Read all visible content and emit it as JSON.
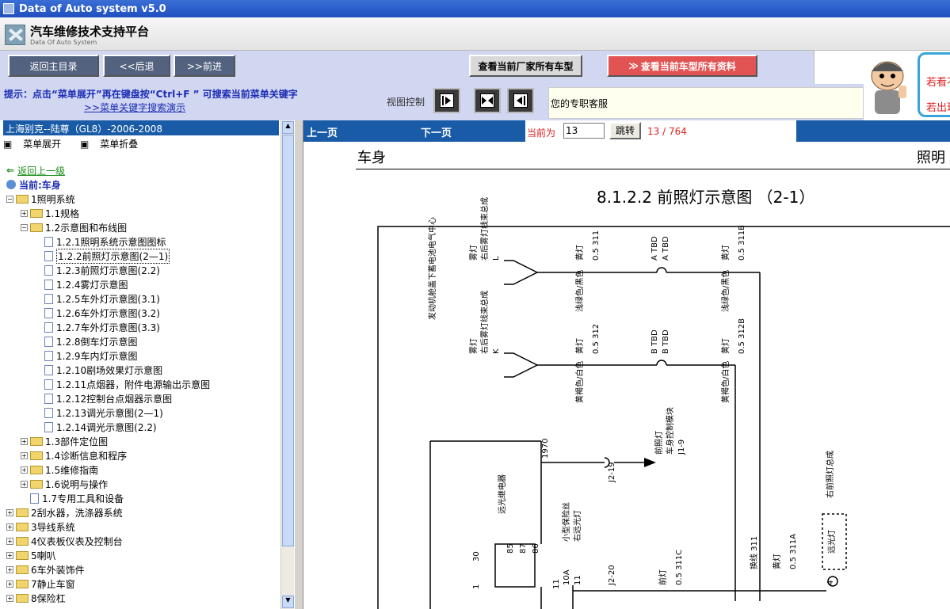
{
  "window": {
    "title": "Data of Auto system v5.0"
  },
  "brand": {
    "title": "汽车维修技术支持平台",
    "subtitle": "Data Of Auto System"
  },
  "nav": {
    "home": "返回主目录",
    "back": "<<后退",
    "forward": ">>前进",
    "makers": "查看当前厂家所有车型",
    "all_data": "查看当前车型所有资料"
  },
  "ad": {
    "line1": "若看不",
    "line2": "若出现"
  },
  "hint": {
    "text": "提示：点击“菜单展开”再在键盘按“Ctrl+F ” 可搜索当前菜单关键字",
    "link": ">>菜单关键字搜索演示",
    "view_control": "视图控制",
    "service": "您的专职客服"
  },
  "tree": {
    "header": "上海别克--陆尊（GL8）-2006-2008",
    "expand": "菜单展开",
    "collapse": "菜单折叠",
    "back_up": "返回上一级",
    "current": "当前:车身",
    "items": [
      {
        "label": "1照明系统",
        "type": "folder",
        "sign": "-",
        "level": 0
      },
      {
        "label": "1.1规格",
        "type": "folder",
        "sign": "+",
        "level": 1
      },
      {
        "label": "1.2示意图和布线图",
        "type": "folder",
        "sign": "-",
        "level": 1
      },
      {
        "label": "1.2.1照明系统示意图图标",
        "type": "doc",
        "level": 2
      },
      {
        "label": "1.2.2前照灯示意图(2—1)",
        "type": "doc",
        "level": 2,
        "selected": true
      },
      {
        "label": "1.2.3前照灯示意图(2.2)",
        "type": "doc",
        "level": 2
      },
      {
        "label": "1.2.4雾灯示意图",
        "type": "doc",
        "level": 2
      },
      {
        "label": "1.2.5车外灯示意图(3.1)",
        "type": "doc",
        "level": 2
      },
      {
        "label": "1.2.6车外灯示意图(3.2)",
        "type": "doc",
        "level": 2
      },
      {
        "label": "1.2.7车外灯示意图(3.3)",
        "type": "doc",
        "level": 2
      },
      {
        "label": "1.2.8倒车灯示意图",
        "type": "doc",
        "level": 2
      },
      {
        "label": "1.2.9车内灯示意图",
        "type": "doc",
        "level": 2
      },
      {
        "label": "1.2.10剧场效果灯示意图",
        "type": "doc",
        "level": 2
      },
      {
        "label": "1.2.11点烟器，附件电源输出示意图",
        "type": "doc",
        "level": 2
      },
      {
        "label": "1.2.12控制台点烟器示意图",
        "type": "doc",
        "level": 2
      },
      {
        "label": "1.2.13调光示意图(2—1)",
        "type": "doc",
        "level": 2
      },
      {
        "label": "1.2.14调光示意图(2.2)",
        "type": "doc",
        "level": 2
      },
      {
        "label": "1.3部件定位图",
        "type": "folder",
        "sign": "+",
        "level": 1
      },
      {
        "label": "1.4诊断信息和程序",
        "type": "folder",
        "sign": "+",
        "level": 1
      },
      {
        "label": "1.5维修指南",
        "type": "folder",
        "sign": "+",
        "level": 1
      },
      {
        "label": "1.6说明与操作",
        "type": "folder",
        "sign": "+",
        "level": 1
      },
      {
        "label": "1.7专用工具和设备",
        "type": "doc",
        "level": 1
      },
      {
        "label": "2刮水器，洗涤器系统",
        "type": "folder",
        "sign": "+",
        "level": 0
      },
      {
        "label": "3导线系统",
        "type": "folder",
        "sign": "+",
        "level": 0
      },
      {
        "label": "4仪表板仪表及控制台",
        "type": "folder",
        "sign": "+",
        "level": 0
      },
      {
        "label": "5喇叭",
        "type": "folder",
        "sign": "+",
        "level": 0
      },
      {
        "label": "6车外装饰件",
        "type": "folder",
        "sign": "+",
        "level": 0
      },
      {
        "label": "7静止车窗",
        "type": "folder",
        "sign": "+",
        "level": 0
      },
      {
        "label": "8保险杠",
        "type": "folder",
        "sign": "+",
        "level": 0
      }
    ]
  },
  "pager": {
    "prev": "上一页",
    "next": "下一页",
    "current_label": "当前为",
    "current_value": "13",
    "go": "跳转",
    "count": "13 / 764"
  },
  "document": {
    "section": "车身",
    "section_right": "照明",
    "figure_title": "8.1.2.2 前照灯示意图 （2-1）",
    "diagram": {
      "rotated_labels": [
        "雾灯",
        "右后雾灯线束总成",
        "L",
        "黄灯",
        "0.5 311",
        "浅绿色/黑色",
        "A TBD",
        "A TBD",
        "黄灯",
        "0.5 311B",
        "浅绿色/黑色",
        "发动机舱盖下蓄电池电气中心",
        "雾灯",
        "右后雾灯线束总成",
        "K",
        "黄灯",
        "0.5 312",
        "黄褐色/白色",
        "B TBD",
        "B TBD",
        "黄灯",
        "0.5 312B",
        "黄褐色/白色",
        "前照灯",
        "车身控制模块",
        "J1-9",
        "1970",
        "J2-19",
        "远光继电器",
        "30",
        "85",
        "87",
        "86",
        "1",
        "11",
        "小型保险丝",
        "右远光灯",
        "10A",
        "11",
        "J2-20",
        "前灯",
        "0.5 311C",
        "换线 311",
        "黄灯",
        "0.5 311A",
        "右前照灯总成",
        "远光灯",
        "4"
      ]
    }
  }
}
